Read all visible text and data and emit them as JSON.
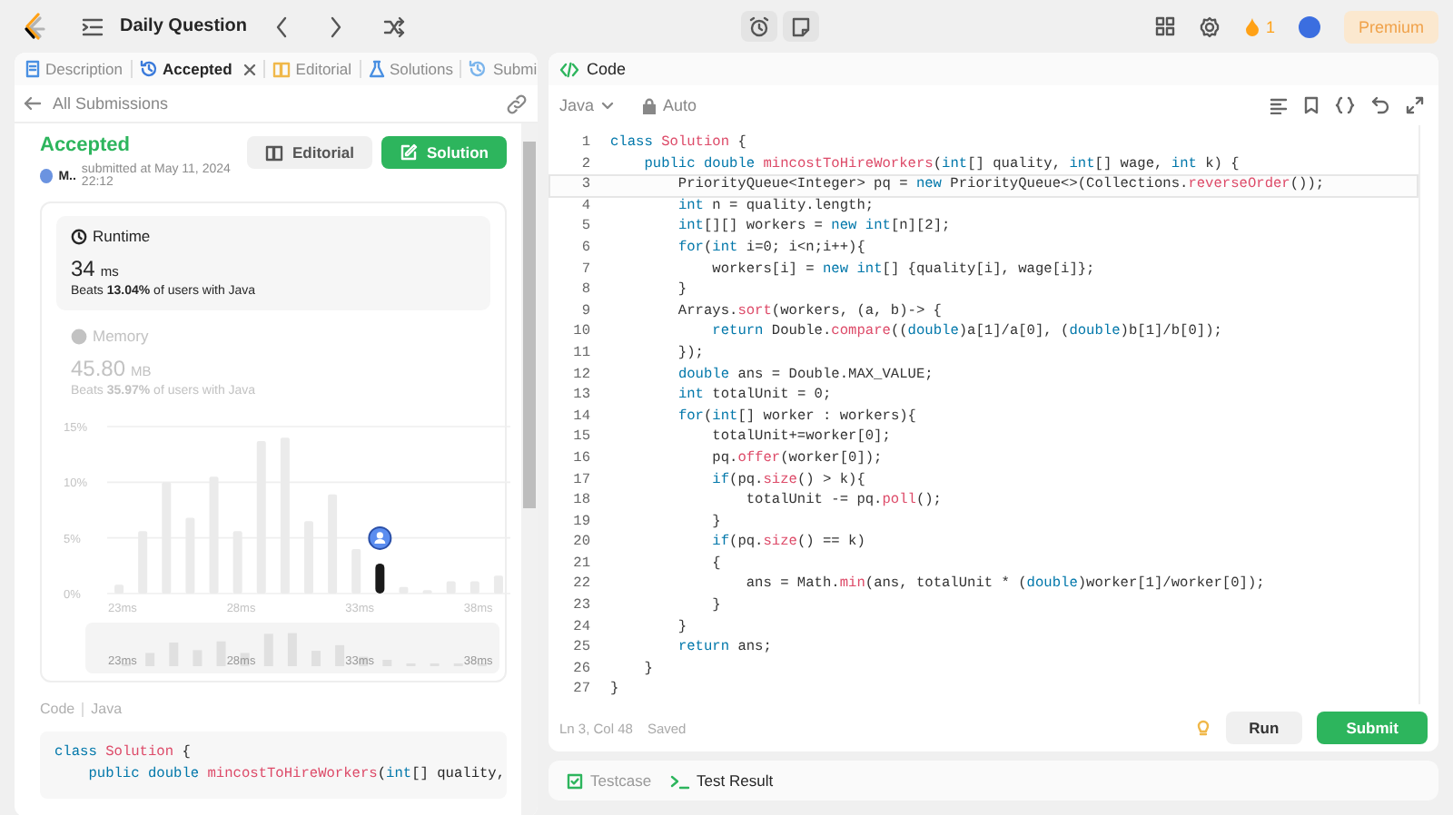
{
  "topbar": {
    "title": "Daily Question",
    "streak": "1",
    "premium": "Premium"
  },
  "left_tabs": [
    {
      "label": "Description",
      "selected": false,
      "closable": false
    },
    {
      "label": "Accepted",
      "selected": true,
      "closable": true
    },
    {
      "label": "Editorial",
      "selected": false,
      "closable": false
    },
    {
      "label": "Solutions",
      "selected": false,
      "closable": false
    },
    {
      "label": "Submi",
      "selected": false,
      "closable": false
    }
  ],
  "back_link": "All Submissions",
  "submission": {
    "status": "Accepted",
    "user": "M..",
    "submitted": "submitted at May 11, 2024 22:12",
    "buttons": [
      {
        "label": "Editorial",
        "kind": "secondary"
      },
      {
        "label": "Solution",
        "kind": "primary"
      }
    ]
  },
  "stats": [
    {
      "label": "Runtime",
      "value": "34",
      "unit": "ms",
      "beats": "Beats **13.04%** of users with Java",
      "selected": true
    },
    {
      "label": "Memory",
      "value": "45.80",
      "unit": "MB",
      "beats": "Beats **35.97%** of users with Java",
      "selected": false
    }
  ],
  "chart_data": {
    "type": "bar",
    "x": [
      23,
      24,
      25,
      26,
      27,
      28,
      29,
      30,
      31,
      32,
      33,
      34,
      35,
      36,
      37,
      38,
      39
    ],
    "values": [
      0.8,
      5.6,
      10,
      6.8,
      10.5,
      5.6,
      13.7,
      14,
      6.5,
      8.9,
      4,
      2.7,
      0.6,
      0.3,
      1.1,
      1.1,
      1.6
    ],
    "xticks": [
      {
        "value": 23,
        "label": "23ms"
      },
      {
        "value": 28,
        "label": "28ms"
      },
      {
        "value": 33,
        "label": "33ms"
      },
      {
        "value": 38,
        "label": "38ms"
      }
    ],
    "yticks": [
      {
        "value": 0,
        "label": "0%"
      },
      {
        "value": 5,
        "label": "5%"
      },
      {
        "value": 10,
        "label": "10%"
      },
      {
        "value": 15,
        "label": "15%"
      }
    ],
    "xlim": [
      22.5,
      39.5
    ],
    "ylim": [
      0,
      15
    ]
  },
  "highlighted_bars": [
    false,
    false,
    false,
    false,
    false,
    false,
    false,
    false,
    false,
    false,
    false,
    true,
    false,
    false,
    false,
    false,
    false
  ],
  "overview_labels": [
    "23ms",
    "28ms",
    "33ms",
    "38ms"
  ],
  "code_preview": {
    "label": "Code",
    "language": "Java",
    "lines": [
      "class Solution {",
      "    public double mincostToHireWorkers(int[] quality,"
    ]
  },
  "editor": {
    "title": "Code",
    "language": "Java",
    "mode": "Auto",
    "lines": [
      {
        "number": "1",
        "text": "class Solution {",
        "active": false
      },
      {
        "number": "2",
        "text": "    public double mincostToHireWorkers(int[] quality, int[] wage, int k) {",
        "active": false
      },
      {
        "number": "3",
        "text": "        PriorityQueue<Integer> pq = new PriorityQueue<>(Collections.reverseOrder());",
        "active": true
      },
      {
        "number": "4",
        "text": "        int n = quality.length;",
        "active": false
      },
      {
        "number": "5",
        "text": "        int[][] workers = new int[n][2];",
        "active": false
      },
      {
        "number": "6",
        "text": "        for(int i=0; i<n;i++){",
        "active": false
      },
      {
        "number": "7",
        "text": "            workers[i] = new int[] {quality[i], wage[i]};",
        "active": false
      },
      {
        "number": "8",
        "text": "        }",
        "active": false
      },
      {
        "number": "9",
        "text": "        Arrays.sort(workers, (a, b)-> {",
        "active": false
      },
      {
        "number": "10",
        "text": "            return Double.compare((double)a[1]/a[0], (double)b[1]/b[0]);",
        "active": false
      },
      {
        "number": "11",
        "text": "        });",
        "active": false
      },
      {
        "number": "12",
        "text": "        double ans = Double.MAX_VALUE;",
        "active": false
      },
      {
        "number": "13",
        "text": "        int totalUnit = 0;",
        "active": false
      },
      {
        "number": "14",
        "text": "        for(int[] worker : workers){",
        "active": false
      },
      {
        "number": "15",
        "text": "            totalUnit+=worker[0];",
        "active": false
      },
      {
        "number": "16",
        "text": "            pq.offer(worker[0]);",
        "active": false
      },
      {
        "number": "17",
        "text": "            if(pq.size() > k){",
        "active": false
      },
      {
        "number": "18",
        "text": "                totalUnit -= pq.poll();",
        "active": false
      },
      {
        "number": "19",
        "text": "            }",
        "active": false
      },
      {
        "number": "20",
        "text": "            if(pq.size() == k)",
        "active": false
      },
      {
        "number": "21",
        "text": "            {",
        "active": false
      },
      {
        "number": "22",
        "text": "                ans = Math.min(ans, totalUnit * (double)worker[1]/worker[0]);",
        "active": false
      },
      {
        "number": "23",
        "text": "            }",
        "active": false
      },
      {
        "number": "24",
        "text": "        }",
        "active": false
      },
      {
        "number": "25",
        "text": "        return ans;",
        "active": false
      },
      {
        "number": "26",
        "text": "    }",
        "active": false
      },
      {
        "number": "27",
        "text": "}",
        "active": false
      }
    ],
    "cursor": "Ln 3, Col 48",
    "save_state": "Saved",
    "buttons": [
      {
        "label": "Run",
        "kind": "secondary"
      },
      {
        "label": "Submit",
        "kind": "primary"
      }
    ]
  },
  "console_tabs": [
    {
      "label": "Testcase",
      "selected": false
    },
    {
      "label": "Test Result",
      "selected": true
    }
  ]
}
